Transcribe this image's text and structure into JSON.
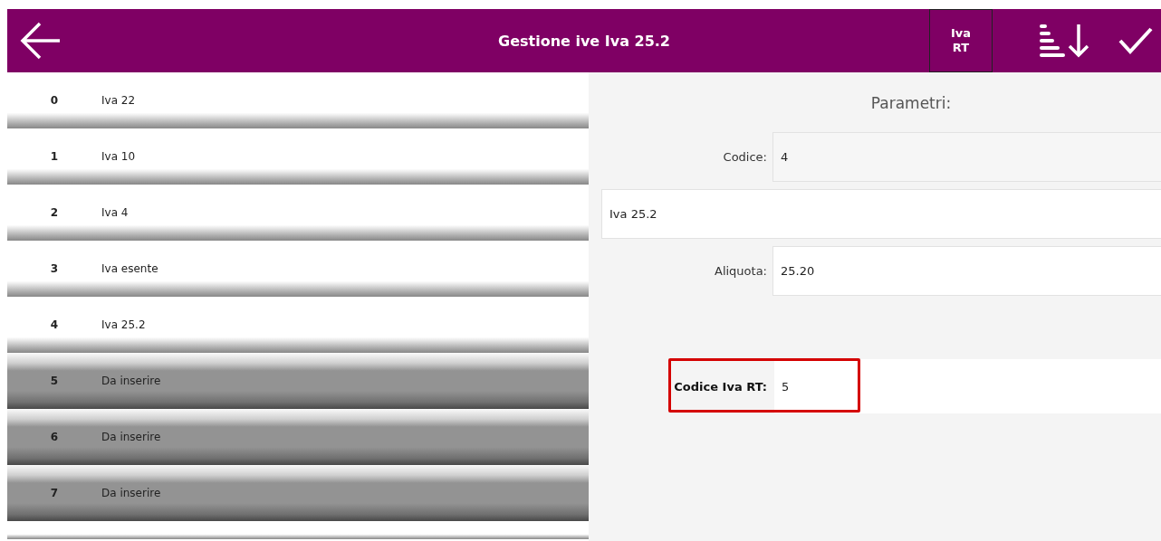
{
  "app_bar": {
    "title": "Gestione ive Iva 25.2",
    "rt_button": "Iva RT"
  },
  "list": [
    {
      "code": "0",
      "name": "Iva 22",
      "kind": "set"
    },
    {
      "code": "1",
      "name": "Iva 10",
      "kind": "set"
    },
    {
      "code": "2",
      "name": "Iva 4",
      "kind": "set"
    },
    {
      "code": "3",
      "name": "Iva esente",
      "kind": "set"
    },
    {
      "code": "4",
      "name": "Iva 25.2",
      "kind": "set"
    },
    {
      "code": "5",
      "name": "Da inserire",
      "kind": "unset"
    },
    {
      "code": "6",
      "name": "Da inserire",
      "kind": "unset"
    },
    {
      "code": "7",
      "name": "Da inserire",
      "kind": "unset"
    }
  ],
  "panel": {
    "title": "Parametri:",
    "codice": {
      "label": "Codice:",
      "value": "4"
    },
    "descrizione": {
      "value": "Iva 25.2"
    },
    "aliquota": {
      "label": "Aliquota:",
      "value": "25.20"
    },
    "codice_rt": {
      "label": "Codice Iva RT:",
      "value": "5",
      "highlighted": true
    }
  }
}
